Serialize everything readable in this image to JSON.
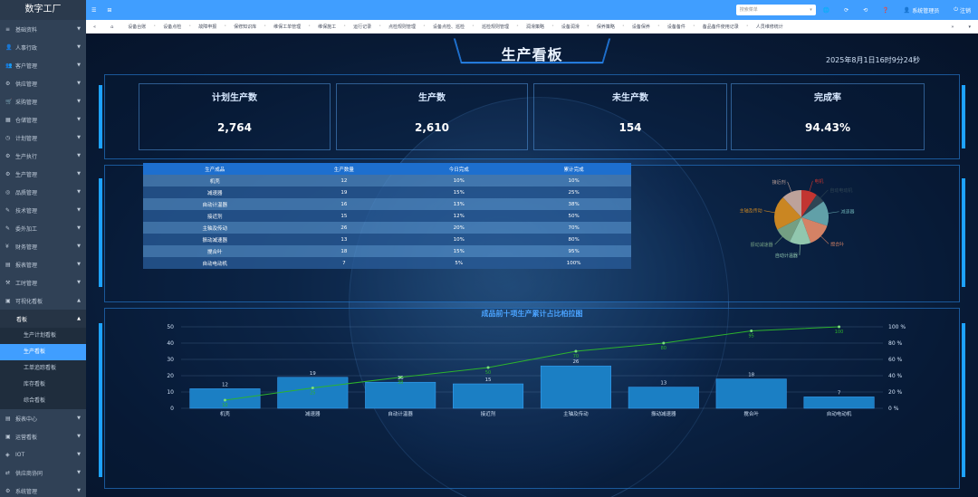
{
  "sidebar": {
    "logo": "数字工厂",
    "items": [
      {
        "icon": "≡",
        "label": "基础资料"
      },
      {
        "icon": "👤",
        "label": "人事行政"
      },
      {
        "icon": "👥",
        "label": "客户管理"
      },
      {
        "icon": "⚙",
        "label": "供应管理"
      },
      {
        "icon": "🛒",
        "label": "采购管理"
      },
      {
        "icon": "▦",
        "label": "仓储管理"
      },
      {
        "icon": "◷",
        "label": "计划管理"
      },
      {
        "icon": "⚙",
        "label": "生产执行"
      },
      {
        "icon": "⚙",
        "label": "生产管理"
      },
      {
        "icon": "◎",
        "label": "品质管理"
      },
      {
        "icon": "✎",
        "label": "技术管理"
      },
      {
        "icon": "✎",
        "label": "委外加工"
      },
      {
        "icon": "¥",
        "label": "财务管理"
      },
      {
        "icon": "▤",
        "label": "报表管理"
      },
      {
        "icon": "⚒",
        "label": "工时管理"
      },
      {
        "icon": "▣",
        "label": "可视化看板"
      }
    ],
    "submenu": {
      "label": "看板"
    },
    "leaves": [
      "生产计划看板",
      "生产看板",
      "工单追踪看板",
      "库存看板",
      "综合看板"
    ],
    "bottom_items": [
      {
        "icon": "▤",
        "label": "报表中心"
      },
      {
        "icon": "▣",
        "label": "运营看板"
      },
      {
        "icon": "◈",
        "label": "IOT"
      },
      {
        "icon": "⇄",
        "label": "供应商协同"
      },
      {
        "icon": "⚙",
        "label": "系统管理"
      }
    ]
  },
  "topbar": {
    "menu_icon": "☰",
    "module_icon": "⊞",
    "search_placeholder": "搜索菜单",
    "icons": [
      "🌐",
      "⟳",
      "⟲",
      "❓"
    ],
    "user": "系统管理员",
    "exit": "注销"
  },
  "tags": [
    "设备台账",
    "设备点检",
    "故障申报",
    "保修知识库",
    "维保工单管理",
    "维保施工",
    "运行记录",
    "点检规则管理",
    "设备点检、巡检",
    "巡检规则管理",
    "润滑策略",
    "设备润滑",
    "保养策略",
    "设备保养",
    "设备备件",
    "备品备件使用记录",
    "人员维修统计"
  ],
  "dashboard": {
    "title": "生产看板",
    "datetime": "2025年8月1日16时9分24秒",
    "stats": [
      {
        "label": "计划生产数",
        "value": "2,764"
      },
      {
        "label": "生产数",
        "value": "2,610"
      },
      {
        "label": "未生产数",
        "value": "154"
      },
      {
        "label": "完成率",
        "value": "94.43%"
      }
    ],
    "table": {
      "headers": [
        "生产成品",
        "生产数量",
        "今日完成",
        "累计完成"
      ],
      "rows": [
        [
          "机壳",
          "12",
          "10%",
          "10%"
        ],
        [
          "减速器",
          "19",
          "15%",
          "25%"
        ],
        [
          "自动计温器",
          "16",
          "13%",
          "38%"
        ],
        [
          "接近剂",
          "15",
          "12%",
          "50%"
        ],
        [
          "主轴及传动",
          "26",
          "20%",
          "70%"
        ],
        [
          "振动减速器",
          "13",
          "10%",
          "80%"
        ],
        [
          "搅合叶",
          "18",
          "15%",
          "95%"
        ],
        [
          "自动电动机",
          "7",
          "5%",
          "100%"
        ]
      ]
    }
  },
  "chart_data": [
    {
      "type": "pie",
      "labels": [
        "电机",
        "自动电动机",
        "减速器",
        "搅合叶",
        "自动计温器",
        "振动减速器",
        "主轴及传动",
        "接近剂"
      ],
      "values": [
        12,
        7,
        19,
        18,
        16,
        13,
        26,
        15
      ],
      "colors": [
        "#c23531",
        "#2f4554",
        "#61a0a8",
        "#d48265",
        "#91c7ae",
        "#749f83",
        "#ca8622",
        "#bda29a"
      ]
    },
    {
      "type": "bar",
      "title": "成品前十项生产累计占比柏拉图",
      "categories": [
        "机壳",
        "减速器",
        "自动计温器",
        "接近剂",
        "主轴及传动",
        "振动减速器",
        "搅合叶",
        "自动电动机"
      ],
      "series": [
        {
          "values": [
            12,
            19,
            16,
            15,
            26,
            13,
            18,
            7
          ]
        }
      ],
      "line_series": {
        "values": [
          10,
          25,
          38,
          50,
          70,
          80,
          95,
          100
        ]
      },
      "ylim": [
        0,
        50
      ],
      "yticks": [
        0,
        10,
        20,
        30,
        40,
        50
      ],
      "y2lim": [
        0,
        100
      ],
      "y2ticks": [
        "0 %",
        "20 %",
        "40 %",
        "60 %",
        "80 %",
        "100 %"
      ]
    }
  ]
}
